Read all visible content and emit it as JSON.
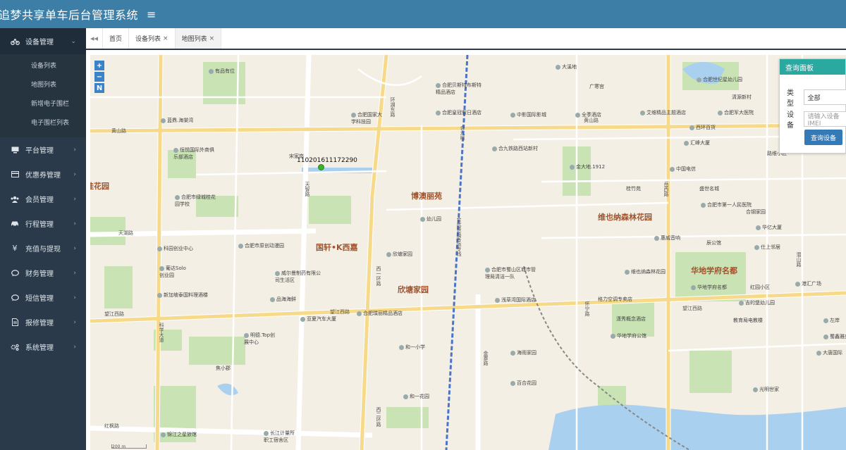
{
  "header": {
    "title": "追梦共享单车后台管理系统",
    "toggle_icon": "≡"
  },
  "sidebar": {
    "groups": [
      {
        "label": "设备管理",
        "icon": "bikes-icon",
        "open": true,
        "items": [
          {
            "label": "设备列表"
          },
          {
            "label": "地图列表"
          },
          {
            "label": "新增电子围栏"
          },
          {
            "label": "电子围栏列表"
          }
        ]
      },
      {
        "label": "平台管理",
        "icon": "monitor-icon"
      },
      {
        "label": "优惠券管理",
        "icon": "card-icon"
      },
      {
        "label": "会员管理",
        "icon": "users-icon"
      },
      {
        "label": "行程管理",
        "icon": "car-icon"
      },
      {
        "label": "充值与提现",
        "icon": "yen-icon"
      },
      {
        "label": "财务管理",
        "icon": "comment-icon"
      },
      {
        "label": "短信管理",
        "icon": "sms-icon"
      },
      {
        "label": "报修管理",
        "icon": "document-icon"
      },
      {
        "label": "系统管理",
        "icon": "gears-icon"
      }
    ]
  },
  "tabs": {
    "items": [
      {
        "label": "首页",
        "closable": false
      },
      {
        "label": "设备列表",
        "closable": true
      },
      {
        "label": "地图列表",
        "closable": true,
        "active": true
      }
    ],
    "close_glyph": "×"
  },
  "map": {
    "zoom_in": "+",
    "zoom_out": "−",
    "north": "N",
    "scale": "200 m",
    "device_id": "110201611172290",
    "areas": [
      {
        "name": "博澳丽苑"
      },
      {
        "name": "国轩•K西嘉"
      },
      {
        "name": "欣塘家园"
      },
      {
        "name": "维也纳森林花园"
      },
      {
        "name": "华地学府名都"
      },
      {
        "name": "桂花园"
      }
    ],
    "roads": [
      "黄山路",
      "望江西路",
      "天湖路",
      "红枫路",
      "望江西路",
      "黄山路",
      "望江西路"
    ],
    "vroads": [
      "科学大道",
      "天智路",
      "环湖东路",
      "西一环路",
      "合九线",
      "合武铁路客运专线",
      "西二环路",
      "金寨路",
      "怀宁路",
      "岳西路",
      "潜山路"
    ],
    "pois": [
      "有品有位",
      "蓝鼎.海棠湾",
      "恒悦国际外商俱乐部酒店",
      "合肥市绿城桂花园学校",
      "科园创业中心",
      "葡达Solo创业园",
      "新加坡泰国料理酒楼",
      "合肥市原创动漫园",
      "威尔曼制药有限公司生活区",
      "品海海鲜",
      "亚夏汽车大厦",
      "明德.Top创展中心",
      "焦小郡",
      "锦江之星旅馆",
      "长江计量所职工宿舍区",
      "宋家岗",
      "合肥国家大学科技园",
      "合肥璞丽精品酒店",
      "幼儿园",
      "欣塘家园",
      "和一小学",
      "和一花园",
      "合肥贝斯特布斯特精品酒店",
      "合肥皇冠假日酒店",
      "大溪地",
      "广寒宫",
      "中影国际影城",
      "全季酒店",
      "合九铁路西站新村",
      "金大地.1912",
      "中国电信",
      "桂竹苑",
      "合肥市蜀山区城市管理局清洁一队",
      "浅草湾国际酒店",
      "海雨家园",
      "百合花园",
      "艾维精品主题酒店",
      "合肥军大医院",
      "西环百货",
      "汇峰大厦",
      "合肥世纪星幼儿园",
      "清源新村",
      "惠威音响",
      "辰公馆",
      "维也纳森林花园",
      "格力空调专卖店",
      "潇秀概念酒店",
      "华地学府公馆",
      "华地学府名都",
      "红园小区",
      "吉的堡幼儿园",
      "教育局电教楼",
      "盛世名城",
      "合肥市第一人民医院",
      "合钢家园",
      "华亿大厦",
      "仕上邻居",
      "光明世家",
      "蜀鑫雅苑",
      "大唐国际",
      "路维小区",
      "港汇广场",
      "左岸"
    ]
  },
  "query_panel": {
    "title": "查询面板",
    "type_label": "类型",
    "type_value": "全部",
    "device_label": "设备",
    "device_placeholder": "请输入设备IMEI",
    "button": "查询设备"
  }
}
